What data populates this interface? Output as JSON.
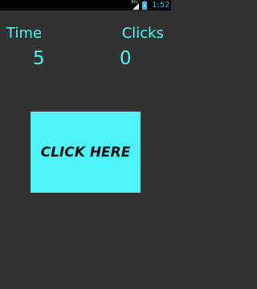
{
  "status_bar": {
    "network": "4G",
    "signal_icon": "signal-strength-icon",
    "battery_icon": "battery-charging-icon",
    "time": "1:52"
  },
  "stats": {
    "time_label": "Time",
    "time_value": "5",
    "clicks_label": "Clicks",
    "clicks_value": "0"
  },
  "button": {
    "label": "CLICK HERE"
  },
  "colors": {
    "background": "#323232",
    "accent": "#4ff4f8",
    "status_time": "#33b5e5",
    "button_text": "#111111"
  }
}
